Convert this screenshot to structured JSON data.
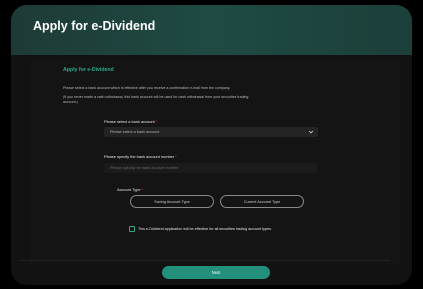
{
  "header": {
    "title": "Apply for e-Dividend"
  },
  "form": {
    "section_title": "Apply for e-Dividend",
    "description_1": "Please select a bank account which is effective after you receive a confirmation e-mail from the company.",
    "description_2": "(If you never made a cash withdrawal, this bank account will be used for cash withdrawal from your securities trading",
    "description_3": "account.)",
    "bank_account_label": "Please select a bank account",
    "bank_account_select": "Please select a bank account",
    "bank_number_label": "Please specify the bank account number",
    "bank_number_placeholder": "Please specify the bank account number",
    "account_type_label": "Account Type",
    "required_mark": "*",
    "saving_account_button": "Saving Account Type",
    "current_account_button": "Current Account Type",
    "checkbox_label": "This e-Dividend application will be effective for all securities trading account types.",
    "next_button": "Next"
  },
  "colors": {
    "header_bg": "#1f4a43",
    "accent": "#2ea88e",
    "button": "#23907c",
    "required": "#e0443a"
  },
  "icons": {
    "select_chevron": "chevron-down-icon"
  }
}
